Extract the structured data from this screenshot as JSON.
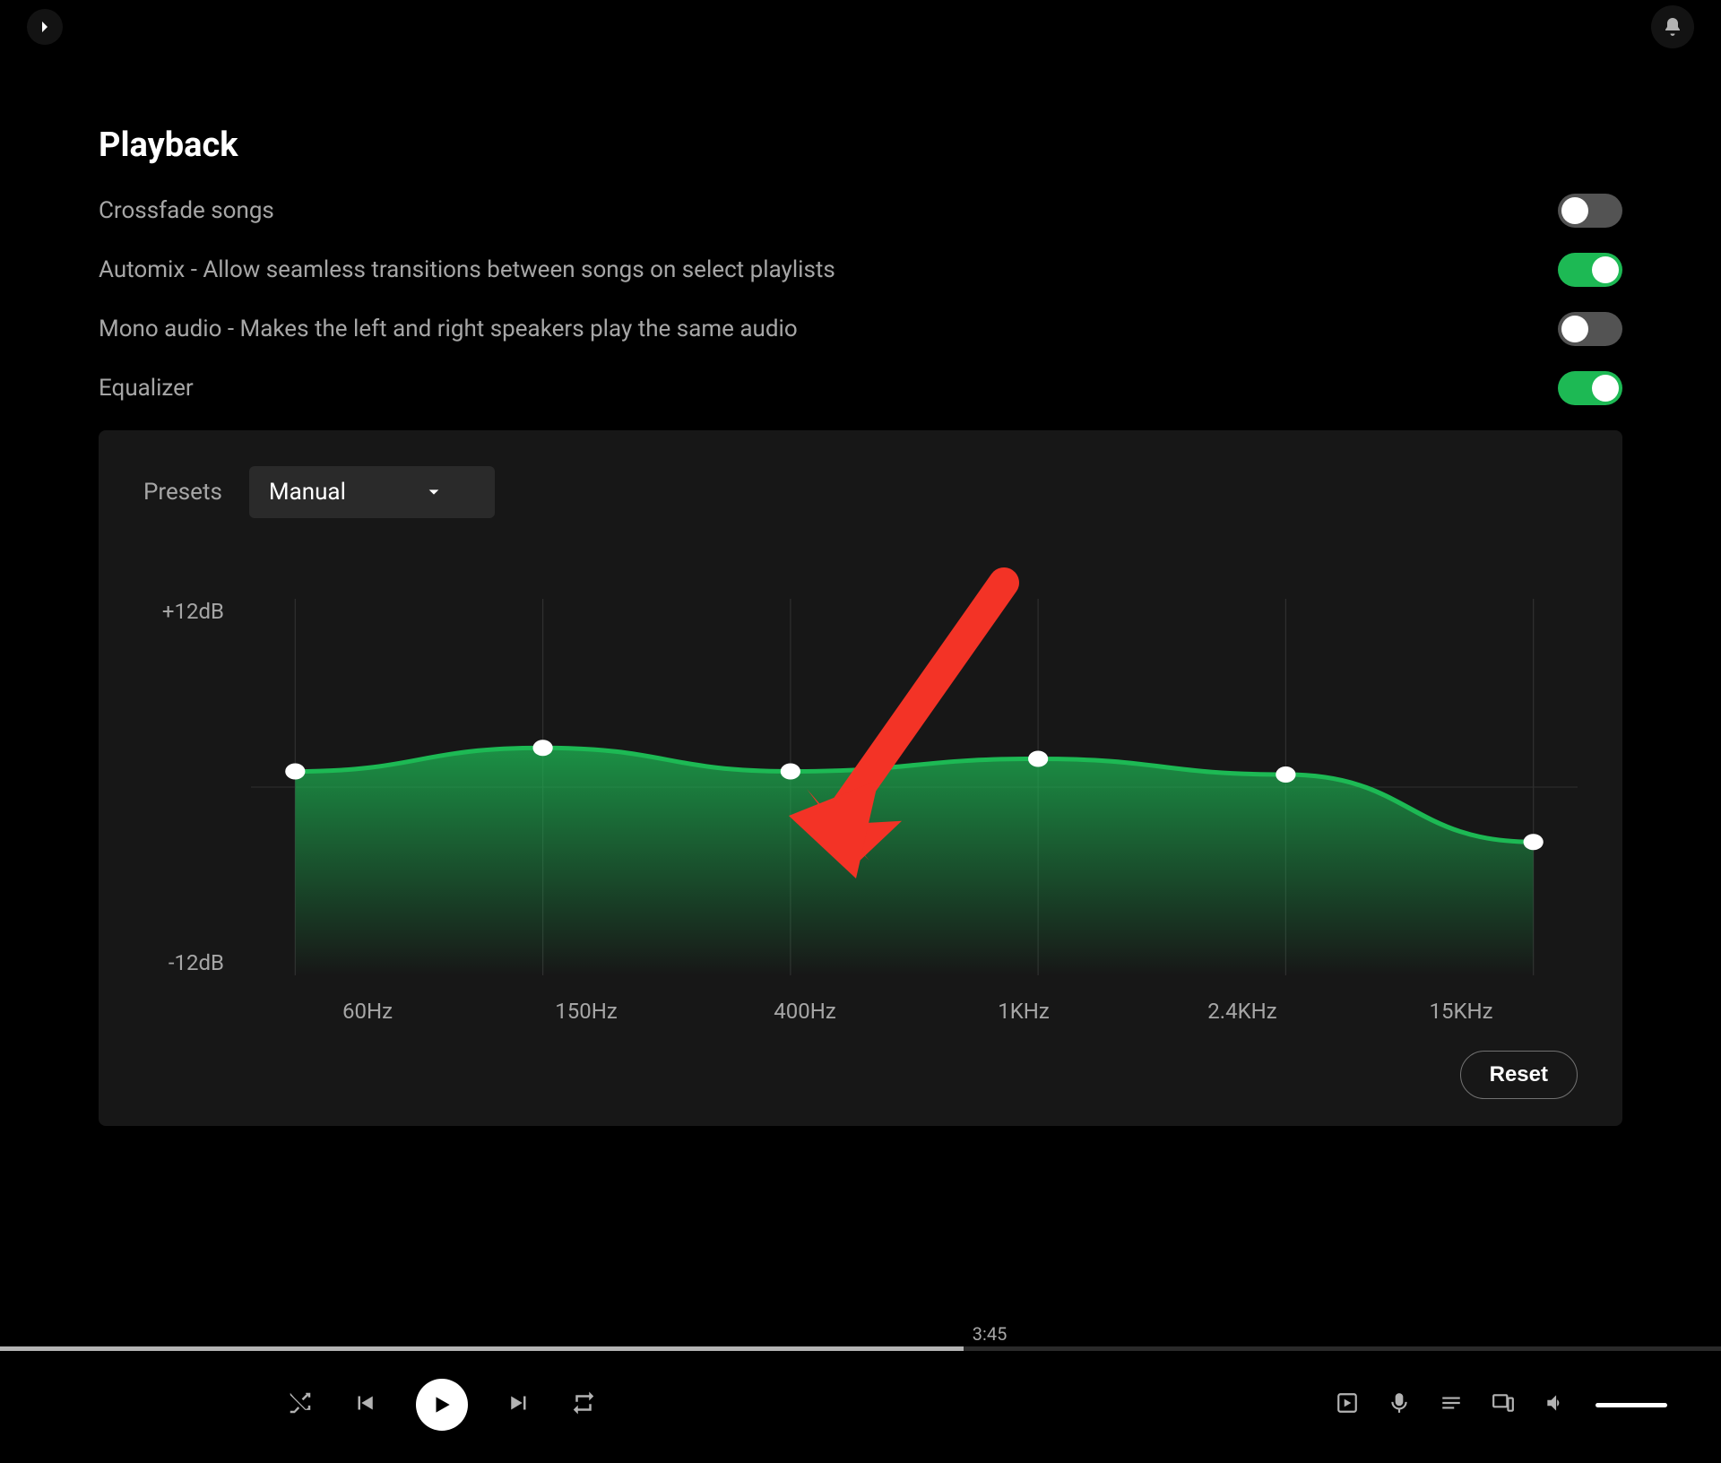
{
  "header": {
    "section_title": "Playback"
  },
  "settings": {
    "crossfade": {
      "label": "Crossfade songs",
      "enabled": false
    },
    "automix": {
      "label": "Automix - Allow seamless transitions between songs on select playlists",
      "enabled": true
    },
    "mono": {
      "label": "Mono audio - Makes the left and right speakers play the same audio",
      "enabled": false
    },
    "equalizer": {
      "label": "Equalizer",
      "enabled": true
    }
  },
  "equalizer": {
    "presets_label": "Presets",
    "preset_selected": "Manual",
    "y_top": "+12dB",
    "y_bottom": "-12dB",
    "reset_label": "Reset"
  },
  "chart_data": {
    "type": "line",
    "categories": [
      "60Hz",
      "150Hz",
      "400Hz",
      "1KHz",
      "2.4KHz",
      "15KHz"
    ],
    "values": [
      1.0,
      2.5,
      1.0,
      1.8,
      0.8,
      -3.5
    ],
    "ylim": [
      -12,
      12
    ],
    "xlabel": "",
    "ylabel": ""
  },
  "player": {
    "elapsed": "3:45"
  },
  "colors": {
    "accent": "#1db954",
    "annotation": "#f33326"
  }
}
